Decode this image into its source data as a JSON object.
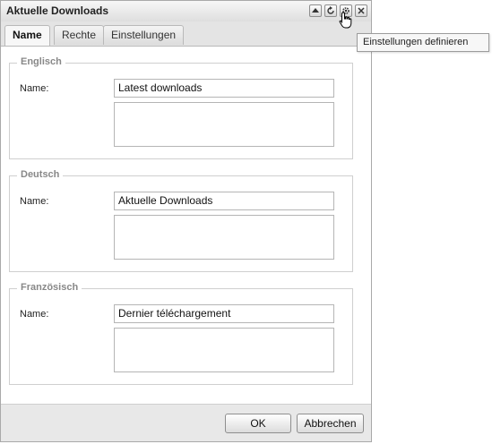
{
  "window": {
    "title": "Aktuelle Downloads",
    "tools": [
      "collapse-icon",
      "refresh-icon",
      "gear-icon",
      "close-icon"
    ]
  },
  "tabs": [
    {
      "label": "Name",
      "active": true
    },
    {
      "label": "Rechte",
      "active": false
    },
    {
      "label": "Einstellungen",
      "active": false
    }
  ],
  "sections": [
    {
      "legend": "Englisch",
      "name_label": "Name:",
      "name_value": "Latest downloads",
      "description": ""
    },
    {
      "legend": "Deutsch",
      "name_label": "Name:",
      "name_value": "Aktuelle Downloads",
      "description": ""
    },
    {
      "legend": "Französisch",
      "name_label": "Name:",
      "name_value": "Dernier téléchargement",
      "description": ""
    }
  ],
  "buttons": {
    "ok": "OK",
    "cancel": "Abbrechen"
  },
  "tooltip": "Einstellungen definieren"
}
